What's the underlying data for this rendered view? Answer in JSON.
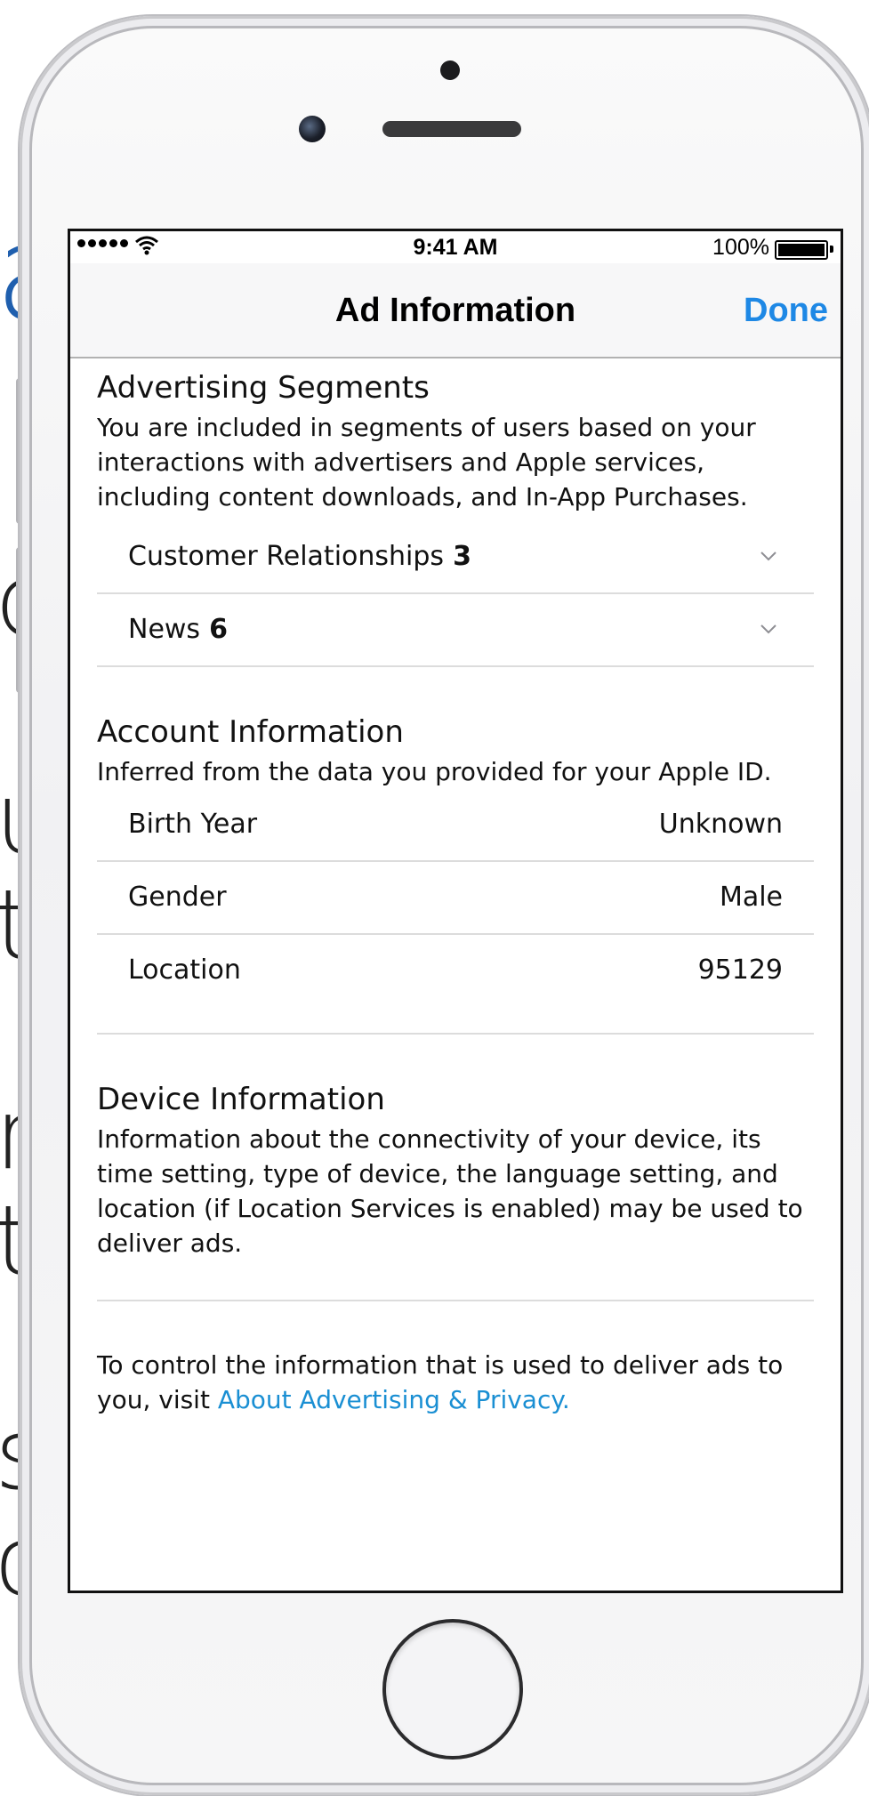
{
  "background_fragments": [
    "a",
    "d",
    "u",
    "t",
    "n",
    "t",
    "s",
    "c"
  ],
  "status_bar": {
    "time": "9:41 AM",
    "battery": "100%"
  },
  "nav": {
    "title": "Ad Information",
    "done": "Done"
  },
  "advertising": {
    "title": "Advertising Segments",
    "description": "You are included in segments of users based on your interactions with advertisers and Apple services, including content downloads, and In-App Purchases.",
    "segments": [
      {
        "label": "Customer Relationships",
        "count": "3"
      },
      {
        "label": "News",
        "count": "6"
      }
    ]
  },
  "account": {
    "title": "Account Information",
    "description": "Inferred from the data you provided for your Apple ID.",
    "rows": [
      {
        "label": "Birth Year",
        "value": "Unknown"
      },
      {
        "label": "Gender",
        "value": "Male"
      },
      {
        "label": "Location",
        "value": "95129"
      }
    ]
  },
  "device": {
    "title": "Device Information",
    "description": "Information about the connectivity of your device, its time setting, type of device, the language setting, and location (if Location Services is enabled) may be used to deliver ads."
  },
  "footer": {
    "text": "To control the information that is used to deliver ads to you, visit ",
    "link": "About Advertising & Privacy."
  },
  "colors": {
    "accent": "#1e88e5",
    "link": "#1a8fd3",
    "background_blue_text": "#1f5fae"
  },
  "icons": {
    "signal": "signal-dots-icon",
    "wifi": "wifi-icon",
    "battery": "battery-icon",
    "chevron": "chevron-down-icon"
  }
}
